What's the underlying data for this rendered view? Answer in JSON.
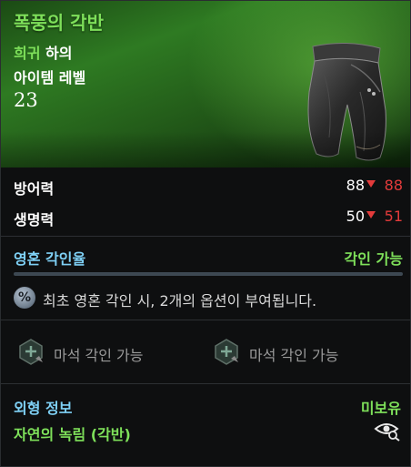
{
  "item": {
    "name": "폭풍의 각반",
    "rarity": "희귀",
    "slot": "하의",
    "level_label": "아이템 레벨",
    "level_value": "23"
  },
  "stats": [
    {
      "label": "방어력",
      "base": "88",
      "current": "88"
    },
    {
      "label": "생명력",
      "base": "50",
      "current": "51"
    }
  ],
  "soul": {
    "label": "영혼 각인율",
    "status": "각인 가능",
    "fill_fraction": 0,
    "info_icon": "percent-icon",
    "info_text": "최초 영혼 각인 시, 2개의 옵션이 부여됩니다."
  },
  "sockets": [
    {
      "label": "마석 각인 가능",
      "icon": "magic-stone-socket-icon"
    },
    {
      "label": "마석 각인 가능",
      "icon": "magic-stone-socket-icon"
    }
  ],
  "appearance": {
    "label": "외형 정보",
    "status": "미보유",
    "name": "자연의 녹림 (각반)",
    "icon": "eye-search-icon"
  },
  "colors": {
    "rarity_green": "#7ee05a",
    "section_blue": "#7ed0f5",
    "stat_down_red": "#e33b3b"
  }
}
